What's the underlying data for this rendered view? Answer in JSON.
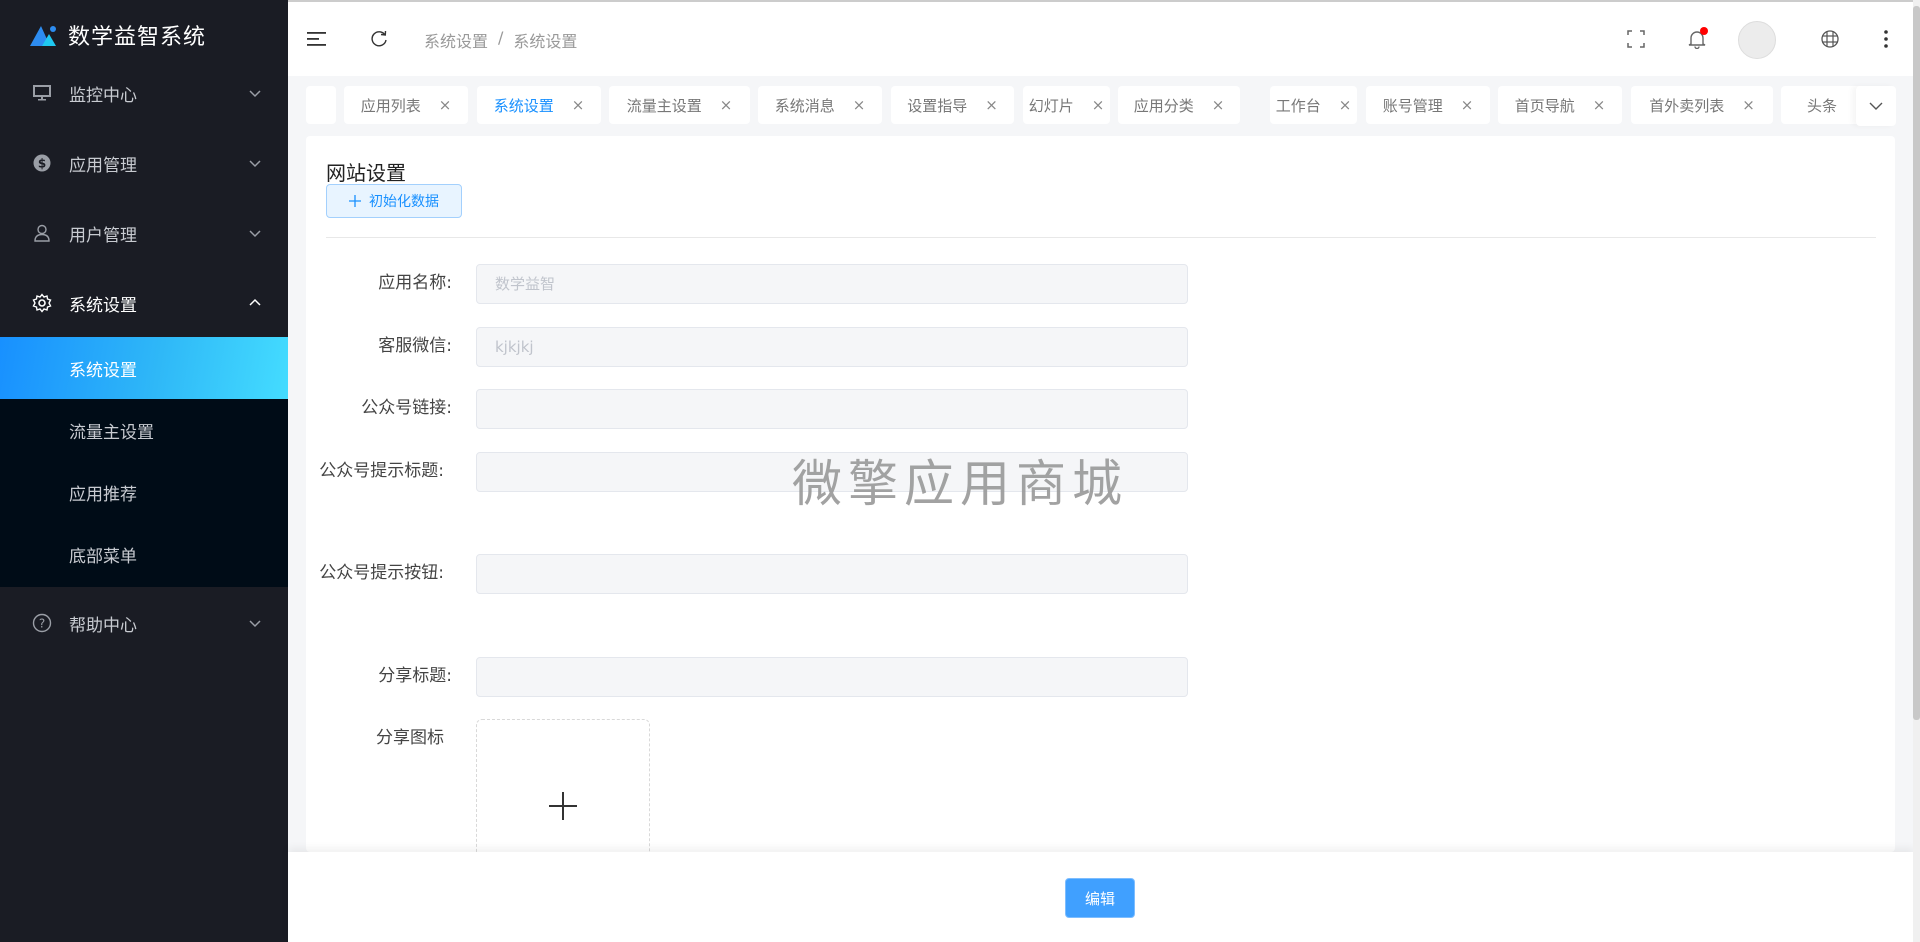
{
  "app": {
    "title": "数学益智系统",
    "brand_color": "#1890ff"
  },
  "sidebar": {
    "items": [
      {
        "label": "监控中心",
        "icon": "monitor-icon",
        "expanded": false
      },
      {
        "label": "应用管理",
        "icon": "dollar-icon",
        "expanded": false
      },
      {
        "label": "用户管理",
        "icon": "user-icon",
        "expanded": false
      },
      {
        "label": "系统设置",
        "icon": "gear-icon",
        "expanded": true,
        "children": [
          {
            "label": "系统设置",
            "active": true
          },
          {
            "label": "流量主设置"
          },
          {
            "label": "应用推荐"
          },
          {
            "label": "底部菜单"
          }
        ]
      },
      {
        "label": "帮助中心",
        "icon": "help-icon",
        "expanded": false
      }
    ]
  },
  "header": {
    "breadcrumb": [
      "系统设置",
      "系统设置"
    ],
    "breadcrumb_separator": "/",
    "icons": [
      "menu-toggle-icon",
      "refresh-icon",
      "fullscreen-icon",
      "bell-icon",
      "avatar",
      "globe-icon",
      "more-icon"
    ],
    "has_notification": true
  },
  "tabs": {
    "items": [
      {
        "label": ""
      },
      {
        "label": "应用列表"
      },
      {
        "label": "系统设置",
        "active": true
      },
      {
        "label": "流量主设置"
      },
      {
        "label": "系统消息"
      },
      {
        "label": "设置指导"
      },
      {
        "label": "幻灯片"
      },
      {
        "label": "应用分类"
      },
      {
        "label": "工作台"
      },
      {
        "label": "账号管理"
      },
      {
        "label": "首页导航"
      },
      {
        "label": "首外卖列表"
      },
      {
        "label": "头条"
      }
    ],
    "close_glyph": "×"
  },
  "form": {
    "title": "网站设置",
    "init_button": "初始化数据",
    "fields": [
      {
        "label": "应用名称:",
        "value": "",
        "placeholder": "数学益智"
      },
      {
        "label": "客服微信:",
        "value": "",
        "placeholder": "kjkjkj"
      },
      {
        "label": "公众号链接:",
        "value": "",
        "placeholder": ""
      },
      {
        "label": "公众号提示标题:",
        "value": "",
        "placeholder": ""
      },
      {
        "label": "公众号提示按钮:",
        "value": "",
        "placeholder": ""
      },
      {
        "label": "分享标题:",
        "value": "",
        "placeholder": ""
      }
    ],
    "upload_label": "分享图标",
    "upload_glyph": "+"
  },
  "watermark": "微擎应用商城",
  "footer": {
    "edit_button": "编辑"
  }
}
